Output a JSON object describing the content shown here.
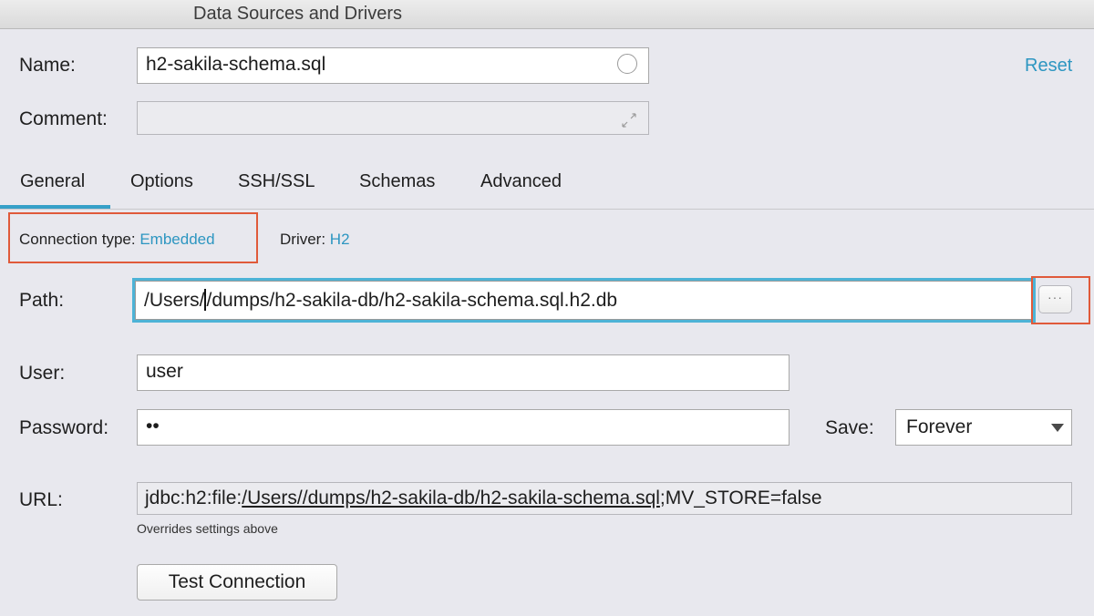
{
  "window": {
    "title": "Data Sources and Drivers"
  },
  "name": {
    "label": "Name:",
    "value": "h2-sakila-schema.sql"
  },
  "comment": {
    "label": "Comment:",
    "value": ""
  },
  "reset_label": "Reset",
  "tabs": [
    {
      "label": "General",
      "active": true
    },
    {
      "label": "Options",
      "active": false
    },
    {
      "label": "SSH/SSL",
      "active": false
    },
    {
      "label": "Schemas",
      "active": false
    },
    {
      "label": "Advanced",
      "active": false
    }
  ],
  "connection": {
    "type_label": "Connection type:",
    "type_value": "Embedded",
    "driver_label": "Driver:",
    "driver_value": "H2"
  },
  "path": {
    "label": "Path:",
    "value_before_caret": "/Users/",
    "value_after_caret": "/dumps/h2-sakila-db/h2-sakila-schema.sql.h2.db",
    "browse_label": "···"
  },
  "user": {
    "label": "User:",
    "value": "user"
  },
  "password": {
    "label": "Password:",
    "value": "••"
  },
  "save": {
    "label": "Save:",
    "selected": "Forever"
  },
  "url": {
    "label": "URL:",
    "prefix": "jdbc:h2:file:",
    "path": "/Users//dumps/h2-sakila-db/h2-sakila-schema.sql",
    "suffix": ";MV_STORE=false",
    "note": "Overrides settings above"
  },
  "test_connection_label": "Test Connection",
  "colors": {
    "accent": "#2d96c1",
    "highlight_box": "#e05a3a",
    "focus_ring": "#4db3d6"
  }
}
